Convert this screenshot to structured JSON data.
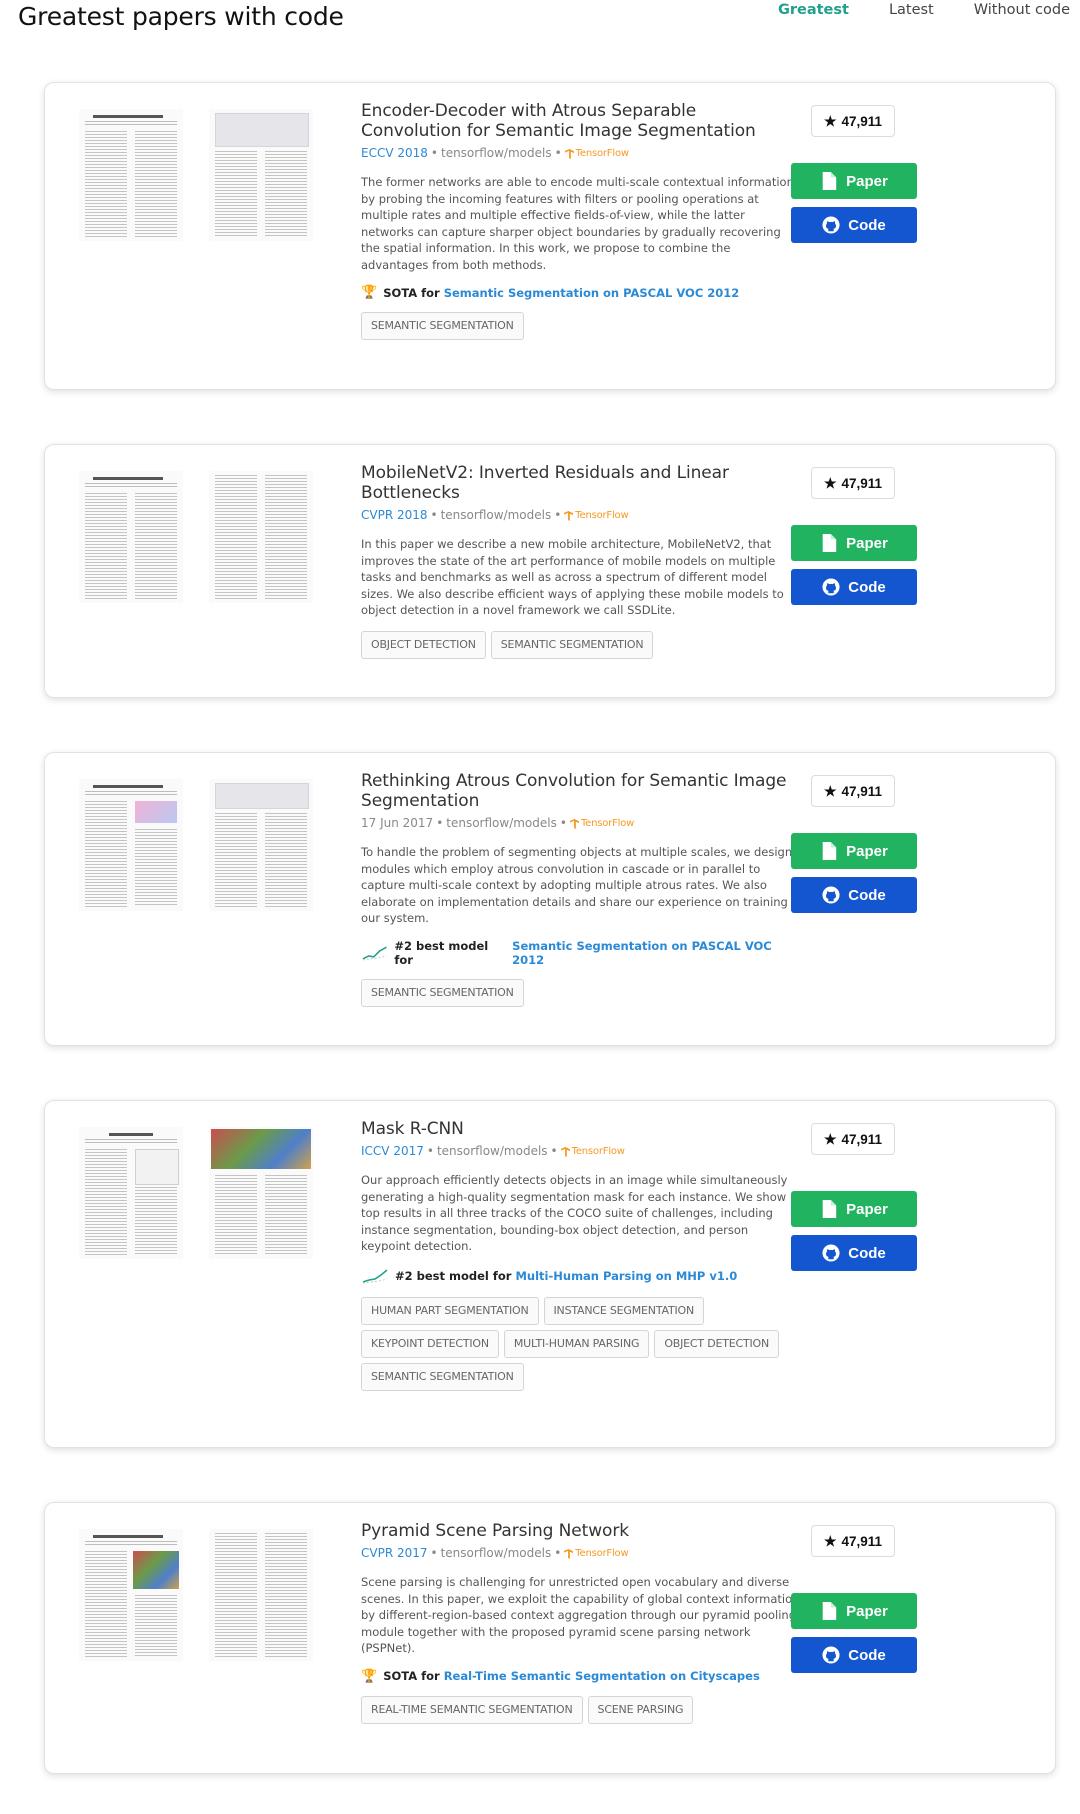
{
  "header": {
    "title": "Greatest papers with code",
    "tabs": [
      {
        "label": "Greatest",
        "active": true
      },
      {
        "label": "Latest",
        "active": false
      },
      {
        "label": "Without code",
        "active": false
      }
    ]
  },
  "labels": {
    "paper_button": "Paper",
    "code_button": "Code",
    "framework": "TensorFlow"
  },
  "colors": {
    "accent": "#21a08d",
    "paper_button": "#21b35f",
    "code_button": "#1356cf",
    "link": "#2b89d6"
  },
  "papers": [
    {
      "title": "Encoder-Decoder with Atrous Separable Convolution for Semantic Image Segmentation",
      "venue": "ECCV 2018",
      "repo": "tensorflow/models",
      "abstract": "The former networks are able to encode multi-scale contextual information by probing the incoming features with filters or pooling operations at multiple rates and multiple effective fields-of-view, while the latter networks can capture sharper object boundaries by gradually recovering the spatial information. In this work, we propose to combine the advantages from both methods.",
      "sota_icon": "trophy-icon",
      "sota_prefix": "SOTA for",
      "sota_link": "Semantic Segmentation on PASCAL VOC 2012",
      "tags": [
        "SEMANTIC SEGMENTATION"
      ],
      "stars": "47,911"
    },
    {
      "title": "MobileNetV2: Inverted Residuals and Linear Bottlenecks",
      "venue": "CVPR 2018",
      "repo": "tensorflow/models",
      "abstract": "In this paper we describe a new mobile architecture, MobileNetV2, that improves the state of the art performance of mobile models on multiple tasks and benchmarks as well as across a spectrum of different model sizes. We also describe efficient ways of applying these mobile models to object detection in a novel framework we call SSDLite.",
      "tags": [
        "OBJECT DETECTION",
        "SEMANTIC SEGMENTATION"
      ],
      "stars": "47,911"
    },
    {
      "title": "Rethinking Atrous Convolution for Semantic Image Segmentation",
      "date": "17 Jun 2017",
      "repo": "tensorflow/models",
      "abstract": "To handle the problem of segmenting objects at multiple scales, we design modules which employ atrous convolution in cascade or in parallel to capture multi-scale context by adopting multiple atrous rates. We also elaborate on implementation details and share our experience on training our system.",
      "sota_icon": "rank-chart-icon",
      "sota_prefix": "#2 best model for",
      "sota_link": "Semantic Segmentation on PASCAL VOC 2012",
      "tags": [
        "SEMANTIC SEGMENTATION"
      ],
      "stars": "47,911"
    },
    {
      "title": "Mask R-CNN",
      "venue": "ICCV 2017",
      "repo": "tensorflow/models",
      "abstract": "Our approach efficiently detects objects in an image while simultaneously generating a high-quality segmentation mask for each instance. We show top results in all three tracks of the COCO suite of challenges, including instance segmentation, bounding-box object detection, and person keypoint detection.",
      "sota_icon": "rank-chart-icon",
      "sota_prefix": "#2 best model for",
      "sota_link": "Multi-Human Parsing on MHP v1.0",
      "tags": [
        "HUMAN PART SEGMENTATION",
        "INSTANCE SEGMENTATION",
        "KEYPOINT DETECTION",
        "MULTI-HUMAN PARSING",
        "OBJECT DETECTION",
        "SEMANTIC SEGMENTATION"
      ],
      "stars": "47,911"
    },
    {
      "title": "Pyramid Scene Parsing Network",
      "venue": "CVPR 2017",
      "repo": "tensorflow/models",
      "abstract": "Scene parsing is challenging for unrestricted open vocabulary and diverse scenes. In this paper, we exploit the capability of global context information by different-region-based context aggregation through our pyramid pooling module together with the proposed pyramid scene parsing network (PSPNet).",
      "sota_icon": "trophy-icon",
      "sota_prefix": "SOTA for",
      "sota_link": "Real-Time Semantic Segmentation on Cityscapes",
      "tags": [
        "REAL-TIME SEMANTIC SEGMENTATION",
        "SCENE PARSING"
      ],
      "stars": "47,911"
    }
  ]
}
